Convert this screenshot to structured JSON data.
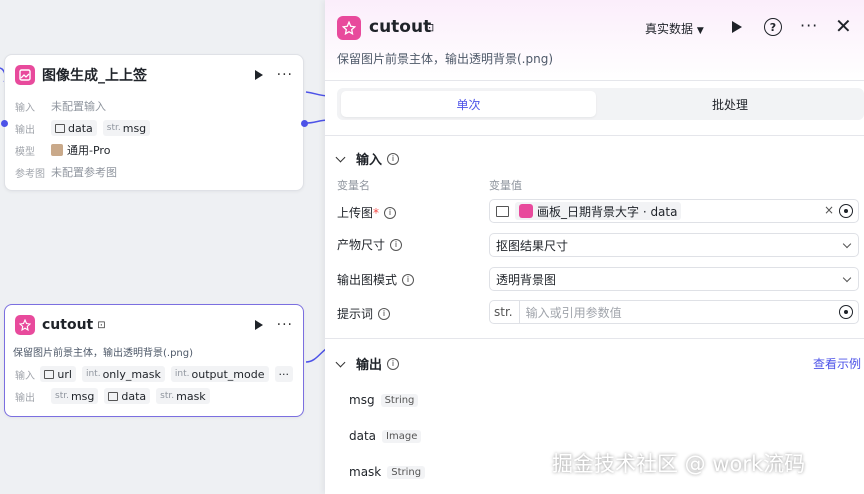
{
  "canvas": {
    "node1": {
      "title": "图像生成_上上签",
      "input_label": "输入",
      "input_value": "未配置输入",
      "output_label": "输出",
      "outputs": [
        {
          "type": "",
          "name": "data",
          "kind": "image"
        },
        {
          "type": "str.",
          "name": "msg",
          "kind": "str"
        }
      ],
      "model_label": "模型",
      "model_value": "通用-Pro",
      "ref_label": "参考图",
      "ref_value": "未配置参考图"
    },
    "node2": {
      "title": "cutout",
      "desc": "保留图片前景主体，输出透明背景(.png)",
      "input_label": "输入",
      "inputs": [
        {
          "type": "",
          "name": "url"
        },
        {
          "type": "int.",
          "name": "only_mask"
        },
        {
          "type": "int.",
          "name": "output_mode"
        }
      ],
      "output_label": "输出",
      "outputs": [
        {
          "type": "str.",
          "name": "msg"
        },
        {
          "type": "",
          "name": "data"
        },
        {
          "type": "str.",
          "name": "mask"
        }
      ],
      "more": "···"
    }
  },
  "panel": {
    "title": "cutout",
    "desc": "保留图片前景主体，输出透明背景(.png)",
    "mode_select": "真实数据",
    "tabs": [
      {
        "label": "单次",
        "active": true
      },
      {
        "label": "批处理",
        "active": false
      }
    ],
    "input_section": "输入",
    "col_name": "变量名",
    "col_value": "变量值",
    "fields": [
      {
        "label": "上传图",
        "required": "*",
        "value": "画板_日期背景大字 · data"
      },
      {
        "label": "产物尺寸",
        "value": "抠图结果尺寸"
      },
      {
        "label": "输出图模式",
        "value": "透明背景图"
      },
      {
        "label": "提示词",
        "prefix": "str.",
        "placeholder": "输入或引用参数值"
      }
    ],
    "output_section": "输出",
    "example_link": "查看示例",
    "outputs": [
      {
        "name": "msg",
        "type": "String"
      },
      {
        "name": "data",
        "type": "Image"
      },
      {
        "name": "mask",
        "type": "String"
      }
    ]
  },
  "watermark": "掘金技术社区 @ work流码",
  "colors": {
    "accent": "#4d53e8",
    "node_icon": "#e84a9c"
  }
}
